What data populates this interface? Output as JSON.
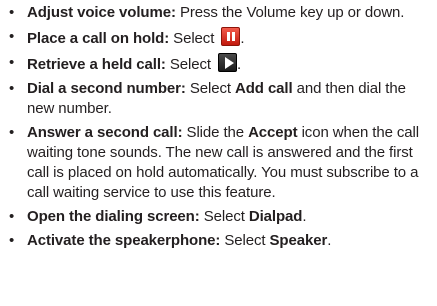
{
  "items": [
    {
      "term": "Adjust voice volume:",
      "text": " Press the Volume key up or down."
    },
    {
      "term": "Place a call on hold:",
      "text": " Select",
      "icon": "pause-icon",
      "after": "."
    },
    {
      "term": "Retrieve a held call:",
      "text": " Select",
      "icon": "play-icon",
      "after": "."
    },
    {
      "term": "Dial a second number:",
      "text1": " Select ",
      "bold1": "Add call",
      "text2": " and then dial the new number."
    },
    {
      "term": "Answer a second call:",
      "text1": " Slide the ",
      "bold1": "Accept",
      "text2": " icon when the call waiting tone sounds. The new call is answered and the first call is placed on hold automatically. You must subscribe to a call waiting service to use this feature."
    },
    {
      "term": "Open the dialing screen:",
      "text1": " Select ",
      "bold1": "Dialpad",
      "text2": "."
    },
    {
      "term": "Activate the speakerphone:",
      "text1": " Select ",
      "bold1": "Speaker",
      "text2": "."
    }
  ],
  "colors": {
    "text": "#231f20",
    "hold_icon": "#d9281b",
    "play_icon": "#2b2b2b"
  }
}
